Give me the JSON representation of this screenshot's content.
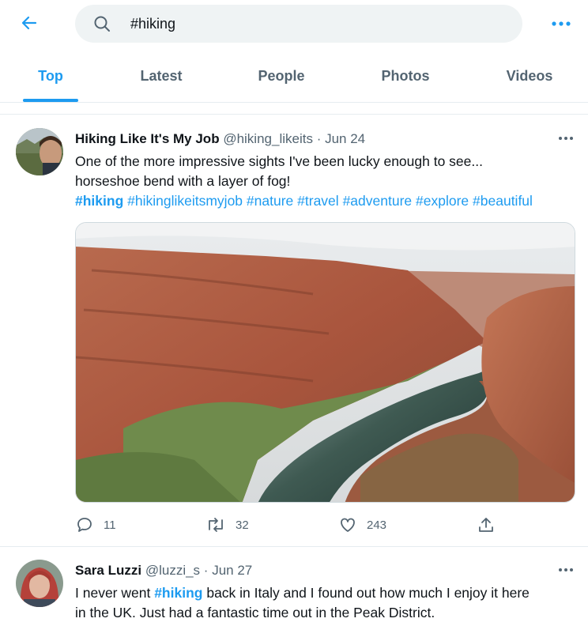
{
  "search": {
    "query": "#hiking"
  },
  "tabs": [
    {
      "label": "Top",
      "active": true
    },
    {
      "label": "Latest",
      "active": false
    },
    {
      "label": "People",
      "active": false
    },
    {
      "label": "Photos",
      "active": false
    },
    {
      "label": "Videos",
      "active": false
    }
  ],
  "colors": {
    "accent": "#1d9bf0",
    "muted": "#536471"
  },
  "tweets": [
    {
      "name": "Hiking Like It's My Job",
      "handle": "@hiking_likeits",
      "separator": "·",
      "date": "Jun 24",
      "text_line1": "One of the more impressive sights I've been lucky enough to see...",
      "text_line2": "horseshoe bend with a layer of fog!",
      "hashtags": [
        "#hiking",
        "#hikinglikeitsmyjob",
        "#nature",
        "#travel",
        "#adventure",
        "#explore",
        "#beautiful"
      ],
      "replies": "11",
      "retweets": "32",
      "likes": "243"
    },
    {
      "name": "Sara Luzzi",
      "handle": "@luzzi_s",
      "separator": "·",
      "date": "Jun 27",
      "text_pre": "I never went ",
      "hashtag": "#hiking",
      "text_post": " back in Italy and I found out how much I enjoy it here",
      "text_line2": "in the UK. Just had a fantastic time out in the Peak District."
    }
  ],
  "icons": {
    "back": "back-arrow-icon",
    "search": "search-icon",
    "more": "more-icon",
    "reply": "reply-icon",
    "retweet": "retweet-icon",
    "like": "like-icon",
    "share": "share-icon"
  }
}
